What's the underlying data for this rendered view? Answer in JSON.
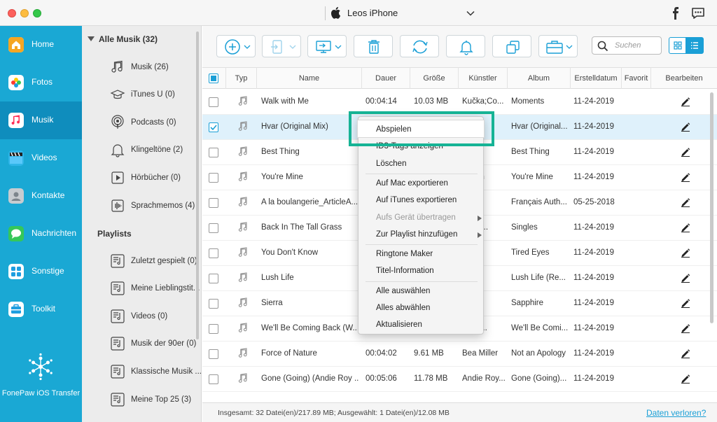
{
  "window": {
    "device_name": "Leos iPhone"
  },
  "nav": {
    "items": [
      {
        "label": "Home",
        "icon": "home-icon",
        "color": "#f5a623"
      },
      {
        "label": "Fotos",
        "icon": "photos-icon",
        "color": "#ff5f57"
      },
      {
        "label": "Musik",
        "icon": "music-icon",
        "color": "#1e9ee0"
      },
      {
        "label": "Videos",
        "icon": "video-icon",
        "color": "#2fb5e8"
      },
      {
        "label": "Kontakte",
        "icon": "contacts-icon",
        "color": "#9aa3aa"
      },
      {
        "label": "Nachrichten",
        "icon": "messages-icon",
        "color": "#35c759"
      },
      {
        "label": "Sonstige",
        "icon": "other-icon",
        "color": "#1e9ee0"
      },
      {
        "label": "Toolkit",
        "icon": "toolkit-icon",
        "color": "#1e9ee0"
      }
    ],
    "app_name": "FonePaw iOS Transfer"
  },
  "categories": {
    "header": "Alle Musik (32)",
    "items": [
      {
        "label": "Musik (26)",
        "icon": "music-note-icon"
      },
      {
        "label": "iTunes U (0)",
        "icon": "graduation-cap-icon"
      },
      {
        "label": "Podcasts (0)",
        "icon": "podcast-icon"
      },
      {
        "label": "Klingeltöne (2)",
        "icon": "bell-icon"
      },
      {
        "label": "Hörbücher (0)",
        "icon": "audiobook-icon"
      },
      {
        "label": "Sprachmemos (4)",
        "icon": "voice-memo-icon"
      }
    ],
    "playlists_header": "Playlists",
    "playlists": [
      {
        "label": "Zuletzt gespielt (0)"
      },
      {
        "label": "Meine Lieblingstit..."
      },
      {
        "label": "Videos (0)"
      },
      {
        "label": "Musik der 90er (0)"
      },
      {
        "label": "Klassische Musik ..."
      },
      {
        "label": "Meine Top 25 (3)"
      }
    ]
  },
  "toolbar": {
    "search_placeholder": "Suchen"
  },
  "table": {
    "columns": [
      "Typ",
      "Name",
      "Dauer",
      "Größe",
      "Künstler",
      "Album",
      "Erstelldatum",
      "Favorit",
      "Bearbeiten"
    ],
    "rows": [
      {
        "name": "Walk with Me",
        "duration": "00:04:14",
        "size": "10.03 MB",
        "artist": "Kučka;Co...",
        "album": "Moments",
        "date": "11-24-2019",
        "checked": false
      },
      {
        "name": "Hvar (Original Mix)",
        "duration": "",
        "size": "",
        "artist": "",
        "album": "Hvar (Original...",
        "date": "11-24-2019",
        "checked": true
      },
      {
        "name": "Best Thing",
        "duration": "",
        "size": "",
        "artist": "Vivet",
        "album": "Best Thing",
        "date": "11-24-2019",
        "checked": false
      },
      {
        "name": "You're Mine",
        "duration": "",
        "size": "",
        "artist": "Marsh",
        "album": "You're Mine",
        "date": "11-24-2019",
        "checked": false
      },
      {
        "name": "A la boulangerie_ArticleA...",
        "duration": "",
        "size": "",
        "artist": "",
        "album": "Français Auth...",
        "date": "05-25-2018",
        "checked": false
      },
      {
        "name": "Back In The Tall Grass",
        "duration": "",
        "size": "",
        "artist": "ue Isl...",
        "album": "Singles",
        "date": "11-24-2019",
        "checked": false
      },
      {
        "name": "You Don't Know",
        "duration": "",
        "size": "",
        "artist": "on T...",
        "album": "Tired Eyes",
        "date": "11-24-2019",
        "checked": false
      },
      {
        "name": "Lush Life",
        "duration": "",
        "size": "",
        "artist": "Lars...",
        "album": "Lush Life (Re...",
        "date": "11-24-2019",
        "checked": false
      },
      {
        "name": "Sierra",
        "duration": "",
        "size": "",
        "artist": "Ill",
        "album": "Sapphire",
        "date": "11-24-2019",
        "checked": false
      },
      {
        "name": "We'll Be Coming Back (W...",
        "duration": "",
        "size": "",
        "artist": "s;Cal...",
        "album": "We'll Be Comi...",
        "date": "11-24-2019",
        "checked": false
      },
      {
        "name": "Force of Nature",
        "duration": "00:04:02",
        "size": "9.61 MB",
        "artist": "Bea Miller",
        "album": "Not an Apology",
        "date": "11-24-2019",
        "checked": false
      },
      {
        "name": "Gone (Going) (Andie Roy ...",
        "duration": "00:05:06",
        "size": "11.78 MB",
        "artist": "Andie Roy...",
        "album": "Gone (Going)...",
        "date": "11-24-2019",
        "checked": false
      }
    ]
  },
  "status": {
    "summary": "Insgesamt: 32 Datei(en)/217.89 MB; Ausgewählt: 1 Datei(en)/12.08 MB",
    "link": "Daten verloren?"
  },
  "context_menu": {
    "items": [
      {
        "label": "Abspielen",
        "disabled": false,
        "submenu": false
      },
      {
        "label": "ID3-Tags anzeigen",
        "disabled": false,
        "submenu": false
      },
      {
        "label": "Löschen",
        "disabled": false,
        "submenu": false
      },
      {
        "label": "Auf Mac exportieren",
        "disabled": false,
        "submenu": false
      },
      {
        "label": "Auf iTunes exportieren",
        "disabled": false,
        "submenu": false
      },
      {
        "label": "Aufs Gerät übertragen",
        "disabled": true,
        "submenu": true
      },
      {
        "label": "Zur Playlist hinzufügen",
        "disabled": false,
        "submenu": true
      },
      {
        "label": "Ringtone Maker",
        "disabled": false,
        "submenu": false
      },
      {
        "label": "Titel-Information",
        "disabled": false,
        "submenu": false
      },
      {
        "label": "Alle auswählen",
        "disabled": false,
        "submenu": false
      },
      {
        "label": "Alles abwählen",
        "disabled": false,
        "submenu": false
      },
      {
        "label": "Aktualisieren",
        "disabled": false,
        "submenu": false
      }
    ],
    "highlight_color": "#16b395"
  }
}
